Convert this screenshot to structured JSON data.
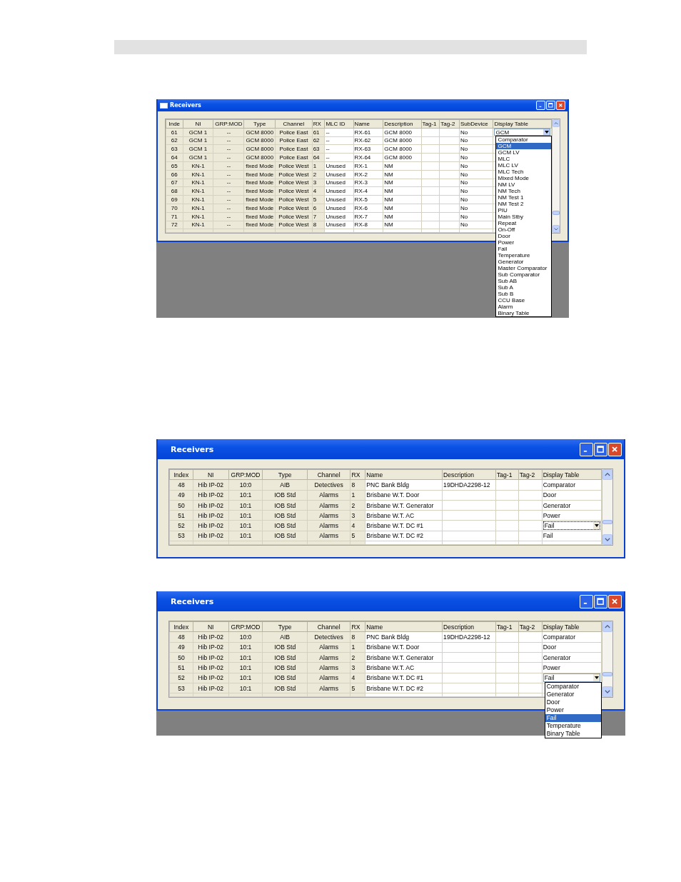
{
  "figures": [
    {
      "kind": "compact",
      "backdrop": true,
      "title": "Receivers",
      "columns": [
        {
          "label": "Inde",
          "read_only": true
        },
        {
          "label": "NI",
          "read_only": true
        },
        {
          "label": "GRP:MOD",
          "read_only": true
        },
        {
          "label": "Type",
          "read_only": true
        },
        {
          "label": "Channel",
          "read_only": true
        },
        {
          "label": "RX",
          "read_only": true
        },
        {
          "label": "MLC ID",
          "read_only": false
        },
        {
          "label": "Name",
          "read_only": false
        },
        {
          "label": "Description",
          "read_only": false
        },
        {
          "label": "Tag-1",
          "read_only": false
        },
        {
          "label": "Tag-2",
          "read_only": false
        },
        {
          "label": "SubDevice",
          "read_only": false
        },
        {
          "label": "Display Table"
        }
      ],
      "rows": [
        {
          "cells": [
            "61",
            "GCM 1",
            "--",
            "GCM 8000",
            "Police East",
            "61",
            "--",
            "RX-61",
            "GCM 8000",
            "",
            "",
            "No"
          ],
          "display": "GCM",
          "editing": true
        },
        {
          "cells": [
            "62",
            "GCM 1",
            "--",
            "GCM 8000",
            "Police East",
            "62",
            "--",
            "RX-62",
            "GCM 8000",
            "",
            "",
            "No"
          ]
        },
        {
          "cells": [
            "63",
            "GCM 1",
            "--",
            "GCM 8000",
            "Police East",
            "63",
            "--",
            "RX-63",
            "GCM 8000",
            "",
            "",
            "No"
          ]
        },
        {
          "cells": [
            "64",
            "GCM 1",
            "--",
            "GCM 8000",
            "Police East",
            "64",
            "--",
            "RX-64",
            "GCM 8000",
            "",
            "",
            "No"
          ]
        },
        {
          "cells": [
            "65",
            "KN-1",
            "--",
            "fixed Mode",
            "Police West",
            "1",
            "Unused",
            "RX-1",
            "NM",
            "",
            "",
            "No"
          ]
        },
        {
          "cells": [
            "66",
            "KN-1",
            "--",
            "fixed Mode",
            "Police West",
            "2",
            "Unused",
            "RX-2",
            "NM",
            "",
            "",
            "No"
          ]
        },
        {
          "cells": [
            "67",
            "KN-1",
            "--",
            "fixed Mode",
            "Police West",
            "3",
            "Unused",
            "RX-3",
            "NM",
            "",
            "",
            "No"
          ]
        },
        {
          "cells": [
            "68",
            "KN-1",
            "--",
            "fixed Mode",
            "Police West",
            "4",
            "Unused",
            "RX-4",
            "NM",
            "",
            "",
            "No"
          ]
        },
        {
          "cells": [
            "69",
            "KN-1",
            "--",
            "fixed Mode",
            "Police West",
            "5",
            "Unused",
            "RX-5",
            "NM",
            "",
            "",
            "No"
          ]
        },
        {
          "cells": [
            "70",
            "KN-1",
            "--",
            "fixed Mode",
            "Police West",
            "6",
            "Unused",
            "RX-6",
            "NM",
            "",
            "",
            "No"
          ]
        },
        {
          "cells": [
            "71",
            "KN-1",
            "--",
            "fixed Mode",
            "Police West",
            "7",
            "Unused",
            "RX-7",
            "NM",
            "",
            "",
            "No"
          ]
        },
        {
          "cells": [
            "72",
            "KN-1",
            "--",
            "fixed Mode",
            "Police West",
            "8",
            "Unused",
            "RX-8",
            "NM",
            "",
            "",
            "No"
          ]
        }
      ],
      "dropdown": {
        "open": true,
        "options": [
          {
            "label": "Comparator",
            "selected": false
          },
          {
            "label": "GCM",
            "selected": true
          },
          {
            "label": "GCM LV",
            "selected": false
          },
          {
            "label": "MLC",
            "selected": false
          },
          {
            "label": "MLC LV",
            "selected": false
          },
          {
            "label": "MLC Tech",
            "selected": false
          },
          {
            "label": "Mixed Mode",
            "selected": false
          },
          {
            "label": "NM LV",
            "selected": false
          },
          {
            "label": "NM Tech",
            "selected": false
          },
          {
            "label": "NM Test 1",
            "selected": false
          },
          {
            "label": "NM Test 2",
            "selected": false
          },
          {
            "label": "PIU",
            "selected": false
          },
          {
            "label": "Main Stby",
            "selected": false
          },
          {
            "label": "Repeat",
            "selected": false
          },
          {
            "label": "On-Off",
            "selected": false
          },
          {
            "label": "Door",
            "selected": false
          },
          {
            "label": "Power",
            "selected": false
          },
          {
            "label": "Fail",
            "selected": false
          },
          {
            "label": "Temperature",
            "selected": false
          },
          {
            "label": "Generator",
            "selected": false
          },
          {
            "label": "Master Comparator",
            "selected": false
          },
          {
            "label": "Sub Comparator",
            "selected": false
          },
          {
            "label": "Sub AB",
            "selected": false
          },
          {
            "label": "Sub A",
            "selected": false
          },
          {
            "label": "Sub B",
            "selected": false
          },
          {
            "label": "CCU Base",
            "selected": false
          },
          {
            "label": "Alarm",
            "selected": false
          },
          {
            "label": "Binary Table",
            "selected": false
          }
        ]
      }
    },
    {
      "kind": "large",
      "title": "Receivers",
      "columns": [
        {
          "label": "Index",
          "read_only": true
        },
        {
          "label": "NI",
          "read_only": true
        },
        {
          "label": "GRP:MOD",
          "read_only": true
        },
        {
          "label": "Type",
          "read_only": true
        },
        {
          "label": "Channel",
          "read_only": true
        },
        {
          "label": "RX",
          "read_only": true
        },
        {
          "label": "Name",
          "read_only": false
        },
        {
          "label": "Description",
          "read_only": false
        },
        {
          "label": "Tag-1",
          "read_only": false
        },
        {
          "label": "Tag-2",
          "read_only": false
        },
        {
          "label": "Display Table",
          "read_only": false
        }
      ],
      "rows": [
        {
          "cells": [
            "48",
            "Hib IP-02",
            "10:0",
            "AIB",
            "Detectives",
            "8",
            "PNC Bank Bldg",
            "19DHDA2298-12",
            "",
            ""
          ],
          "display": "Comparator",
          "editing": false
        },
        {
          "cells": [
            "49",
            "Hib IP-02",
            "10:1",
            "IOB Std",
            "Alarms",
            "1",
            "Brisbane W.T. Door",
            "",
            "",
            ""
          ],
          "display": "Door",
          "editing": false
        },
        {
          "cells": [
            "50",
            "Hib IP-02",
            "10:1",
            "IOB Std",
            "Alarms",
            "2",
            "Brisbane W.T. Generator",
            "",
            "",
            ""
          ],
          "display": "Generator",
          "editing": false
        },
        {
          "cells": [
            "51",
            "Hib IP-02",
            "10:1",
            "IOB Std",
            "Alarms",
            "3",
            "Brisbane W.T. AC",
            "",
            "",
            ""
          ],
          "display": "Power",
          "editing": false
        },
        {
          "cells": [
            "52",
            "Hib IP-02",
            "10:1",
            "IOB Std",
            "Alarms",
            "4",
            "Brisbane W.T. DC #1",
            "",
            "",
            ""
          ],
          "display": "Fail",
          "editing": true
        },
        {
          "cells": [
            "53",
            "Hib IP-02",
            "10:1",
            "IOB Std",
            "Alarms",
            "5",
            "Brisbane W.T. DC #2",
            "",
            "",
            ""
          ],
          "display": "Fail",
          "editing": false
        }
      ],
      "dropdown": {
        "open": false
      }
    },
    {
      "kind": "large",
      "backdrop": true,
      "title": "Receivers",
      "columns": [
        {
          "label": "Index",
          "read_only": true
        },
        {
          "label": "NI",
          "read_only": true
        },
        {
          "label": "GRP:MOD",
          "read_only": true
        },
        {
          "label": "Type",
          "read_only": true
        },
        {
          "label": "Channel",
          "read_only": true
        },
        {
          "label": "RX",
          "read_only": true
        },
        {
          "label": "Name",
          "read_only": false
        },
        {
          "label": "Description",
          "read_only": false
        },
        {
          "label": "Tag-1",
          "read_only": false
        },
        {
          "label": "Tag-2",
          "read_only": false
        },
        {
          "label": "Display Table",
          "read_only": false
        }
      ],
      "rows": [
        {
          "cells": [
            "48",
            "Hib IP-02",
            "10:0",
            "AIB",
            "Detectives",
            "8",
            "PNC Bank Bldg",
            "19DHDA2298-12",
            "",
            ""
          ],
          "display": "Comparator",
          "editing": false
        },
        {
          "cells": [
            "49",
            "Hib IP-02",
            "10:1",
            "IOB Std",
            "Alarms",
            "1",
            "Brisbane W.T. Door",
            "",
            "",
            ""
          ],
          "display": "Door",
          "editing": false
        },
        {
          "cells": [
            "50",
            "Hib IP-02",
            "10:1",
            "IOB Std",
            "Alarms",
            "2",
            "Brisbane W.T. Generator",
            "",
            "",
            ""
          ],
          "display": "Generator",
          "editing": false
        },
        {
          "cells": [
            "51",
            "Hib IP-02",
            "10:1",
            "IOB Std",
            "Alarms",
            "3",
            "Brisbane W.T. AC",
            "",
            "",
            ""
          ],
          "display": "Power",
          "editing": false
        },
        {
          "cells": [
            "52",
            "Hib IP-02",
            "10:1",
            "IOB Std",
            "Alarms",
            "4",
            "Brisbane W.T. DC #1",
            "",
            "",
            ""
          ],
          "display": "Fail",
          "editing": true
        },
        {
          "cells": [
            "53",
            "Hib IP-02",
            "10:1",
            "IOB Std",
            "Alarms",
            "5",
            "Brisbane W.T. DC #2",
            "",
            "",
            ""
          ],
          "editing": false
        }
      ],
      "dropdown": {
        "open": true,
        "options": [
          {
            "label": "Comparator",
            "selected": false
          },
          {
            "label": "Generator",
            "selected": false
          },
          {
            "label": "Door",
            "selected": false
          },
          {
            "label": "Power",
            "selected": false
          },
          {
            "label": "Fail",
            "selected": true
          },
          {
            "label": "Temperature",
            "selected": false
          },
          {
            "label": "Binary Table",
            "selected": false
          }
        ]
      }
    }
  ]
}
